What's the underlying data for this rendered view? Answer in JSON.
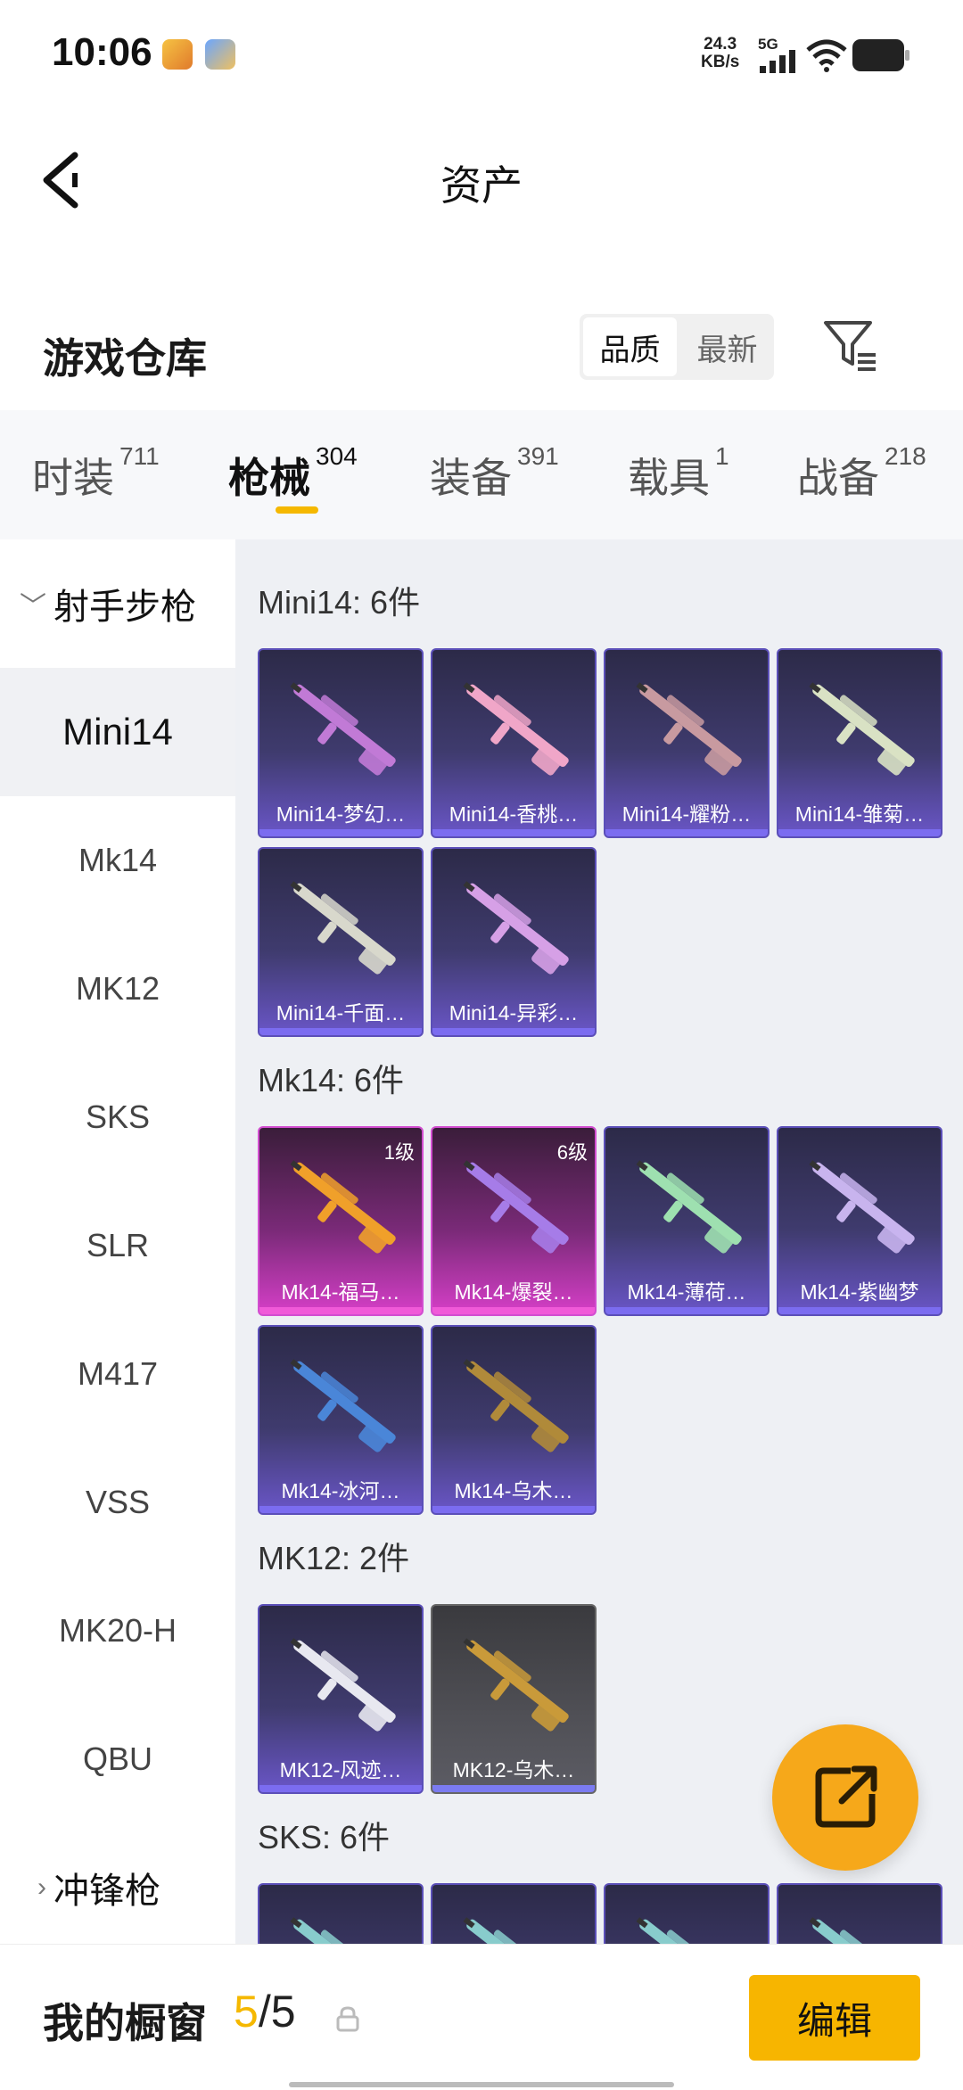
{
  "status_bar": {
    "time": "10:06",
    "net_speed_value": "24.3",
    "net_speed_unit": "KB/s",
    "network_type": "5G"
  },
  "header": {
    "title": "资产"
  },
  "warehouse": {
    "title": "游戏仓库",
    "sort_options": [
      "品质",
      "最新"
    ]
  },
  "tabs": [
    {
      "label": "时装",
      "count": "711"
    },
    {
      "label": "枪械",
      "count": "304"
    },
    {
      "label": "装备",
      "count": "391"
    },
    {
      "label": "载具",
      "count": "1"
    },
    {
      "label": "战备",
      "count": "218"
    }
  ],
  "sidebar": {
    "category_expanded": "射手步枪",
    "items": [
      "Mini14",
      "Mk14",
      "MK12",
      "SKS",
      "SLR",
      "M417",
      "VSS",
      "MK20-H",
      "QBU"
    ],
    "category_collapsed": "冲锋枪"
  },
  "sections": [
    {
      "title": "Mini14: 6件",
      "items": [
        {
          "name": "Mini14-梦幻…",
          "level": "",
          "color": "#c17ad6"
        },
        {
          "name": "Mini14-香桃…",
          "level": "",
          "color": "#f0a6c8"
        },
        {
          "name": "Mini14-耀粉…",
          "level": "",
          "color": "#c89aa0"
        },
        {
          "name": "Mini14-雏菊…",
          "level": "",
          "color": "#d9e2c4"
        },
        {
          "name": "Mini14-千面…",
          "level": "",
          "color": "#d8d8cc"
        },
        {
          "name": "Mini14-异彩…",
          "level": "",
          "color": "#d6a0e6"
        }
      ]
    },
    {
      "title": "Mk14: 6件",
      "items": [
        {
          "name": "Mk14-福马…",
          "level": "1级",
          "color": "#f0a02a"
        },
        {
          "name": "Mk14-爆裂…",
          "level": "6级",
          "color": "#a67ce8"
        },
        {
          "name": "Mk14-薄荷…",
          "level": "",
          "color": "#9ee0b0"
        },
        {
          "name": "Mk14-紫幽梦",
          "level": "",
          "color": "#c8b4ee"
        },
        {
          "name": "Mk14-冰河…",
          "level": "",
          "color": "#4a86d8"
        },
        {
          "name": "Mk14-乌木…",
          "level": "",
          "color": "#b08a3a"
        }
      ]
    },
    {
      "title": "MK12: 2件",
      "items": [
        {
          "name": "MK12-风迹…",
          "level": "",
          "color": "#e8e8f0"
        },
        {
          "name": "MK12-乌木…",
          "level": "",
          "color": "#c99a3a"
        }
      ]
    },
    {
      "title": "SKS: 6件",
      "items": []
    }
  ],
  "bottom_bar": {
    "label": "我的橱窗",
    "count_current": "5",
    "count_separator": "/",
    "count_total": "5",
    "edit_label": "编辑"
  },
  "colors": {
    "accent": "#f5b800",
    "card_blue": "#6a56c8",
    "card_pink": "#d63fc8"
  }
}
